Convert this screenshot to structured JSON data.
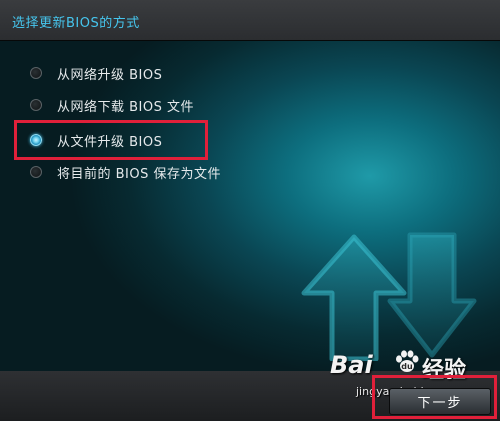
{
  "dialog": {
    "title": "选择更新BIOS的方式"
  },
  "options": [
    {
      "label": "从网络升级 BIOS",
      "checked": false
    },
    {
      "label": "从网络下载 BIOS 文件",
      "checked": false
    },
    {
      "label": "从文件升级 BIOS",
      "checked": true
    },
    {
      "label": "将目前的 BIOS 保存为文件",
      "checked": false
    }
  ],
  "footer": {
    "next_label": "下一步"
  },
  "watermark": {
    "logo_text": "Bai",
    "logo_suffix": "经验",
    "url": "jingyan.baidu.com"
  },
  "colors": {
    "title": "#46c6ee",
    "highlight": "#e0203a",
    "radio_selected": "#6fd3ef"
  },
  "icons": [
    "update-arrows-icon",
    "radio-icon",
    "baidu-paw-icon"
  ]
}
